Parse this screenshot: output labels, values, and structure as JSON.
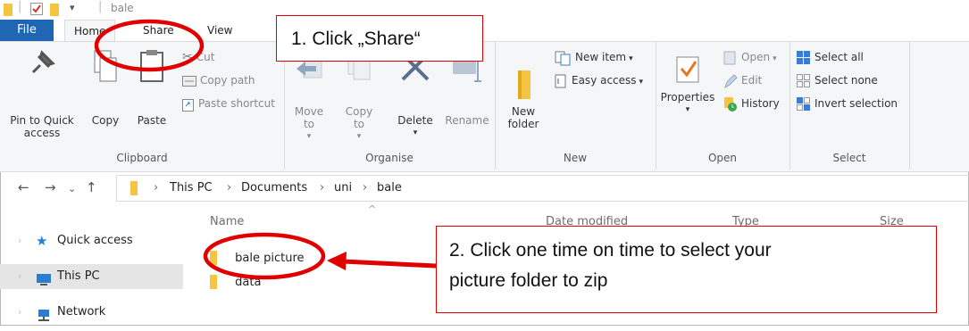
{
  "window": {
    "title": "bale"
  },
  "tabs": [
    {
      "label": "File"
    },
    {
      "label": "Home"
    },
    {
      "label": "Share"
    },
    {
      "label": "View"
    }
  ],
  "ribbon": {
    "clipboard": {
      "label": "Clipboard",
      "pin": "Pin to Quick access",
      "copy": "Copy",
      "paste": "Paste",
      "cut": "Cut",
      "copy_path": "Copy path",
      "paste_shortcut": "Paste shortcut"
    },
    "organise": {
      "label": "Organise",
      "move_to": "Move to",
      "copy_to": "Copy to",
      "delete": "Delete",
      "rename": "Rename"
    },
    "new": {
      "label": "New",
      "new_folder": "New folder",
      "new_item": "New item",
      "easy_access": "Easy access"
    },
    "open": {
      "label": "Open",
      "properties": "Properties",
      "open": "Open",
      "edit": "Edit",
      "history": "History"
    },
    "select": {
      "label": "Select",
      "select_all": "Select all",
      "select_none": "Select none",
      "invert_selection": "Invert selection"
    }
  },
  "address": {
    "crumbs": [
      "This PC",
      "Documents",
      "uni",
      "bale"
    ]
  },
  "nav": [
    {
      "label": "Quick access"
    },
    {
      "label": "This PC"
    },
    {
      "label": "Network"
    }
  ],
  "columns": [
    "Name",
    "Date modified",
    "Type",
    "Size"
  ],
  "files": [
    {
      "name": "bale picture"
    },
    {
      "name": "data"
    }
  ],
  "annotations": {
    "step1": "1. Click „Share“",
    "step2_line1": "2. Click one time on time to select your",
    "step2_line2": "picture folder to zip"
  },
  "colors": {
    "file_tab": "#1f67b2",
    "folder": "#f5c542",
    "annotation_red": "#e00000"
  }
}
